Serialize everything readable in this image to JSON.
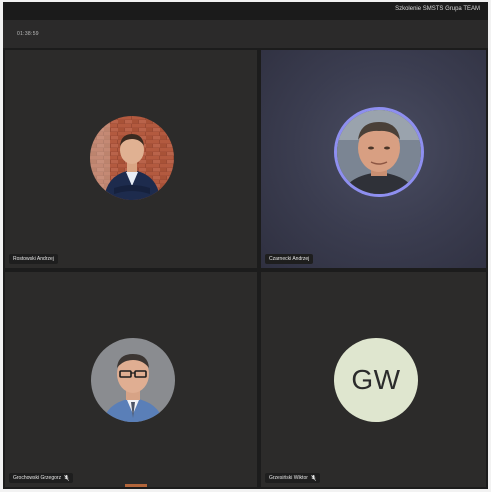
{
  "header": {
    "meeting_title": "Szkolenie SMSTS Grupa TEAM",
    "timer": "01:38:59"
  },
  "participants": [
    {
      "name": "Rostowski Andrzej",
      "avatar": "photo",
      "muted": false
    },
    {
      "name": "Czarnecki Andrzej",
      "avatar": "photo",
      "muted": false,
      "speaking": true
    },
    {
      "name": "Grochowski Grzegorz",
      "avatar": "photo",
      "muted": true
    },
    {
      "name": "Grzesiński Wiktor",
      "avatar": "initials",
      "initials": "GW",
      "muted": true
    }
  ],
  "colors": {
    "speaking_ring": "#8e8ff0",
    "initials_bg": "#dfe6cf",
    "tile_bg": "#2c2b2a"
  }
}
